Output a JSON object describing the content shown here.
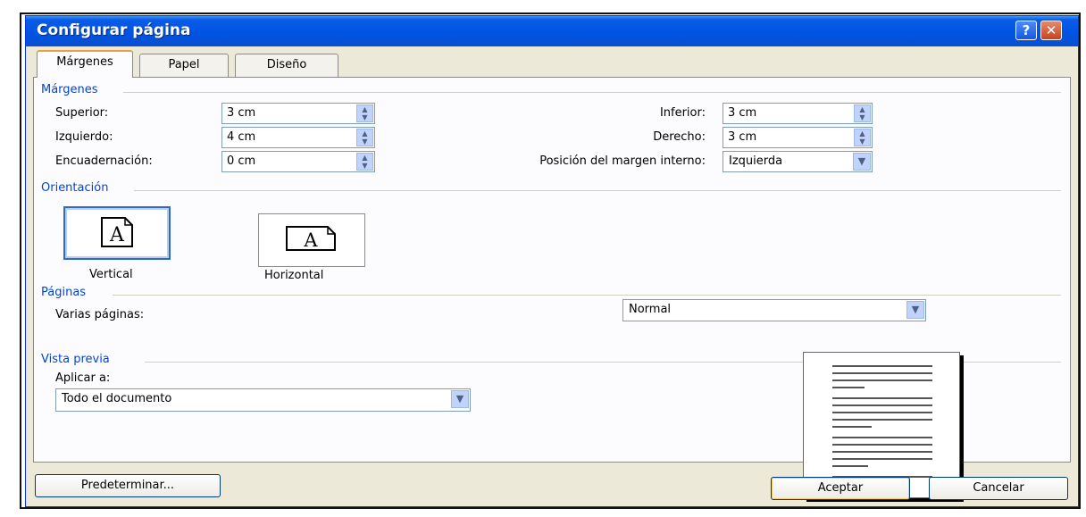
{
  "window": {
    "title": "Configurar página",
    "help_glyph": "?",
    "close_glyph": "✕"
  },
  "tabs": [
    {
      "label": "Márgenes",
      "active": true
    },
    {
      "label": "Papel"
    },
    {
      "label": "Diseño"
    }
  ],
  "margins": {
    "section_title": "Márgenes",
    "superior": {
      "label": "Superior:",
      "value": "3 cm"
    },
    "izquierdo": {
      "label": "Izquierdo:",
      "value": "4 cm"
    },
    "encuadernacion": {
      "label": "Encuadernación:",
      "value": "0 cm"
    },
    "inferior": {
      "label": "Inferior:",
      "value": "3 cm"
    },
    "derecho": {
      "label": "Derecho:",
      "value": "3 cm"
    },
    "posicion": {
      "label": "Posición del margen interno:",
      "value": "Izquierda"
    }
  },
  "orientation": {
    "section_title": "Orientación",
    "vertical": "Vertical",
    "horizontal": "Horizontal",
    "selected": "Vertical",
    "glyph": "A"
  },
  "pages": {
    "section_title": "Páginas",
    "label": "Varias páginas:",
    "value": "Normal"
  },
  "preview": {
    "section_title": "Vista previa",
    "apply_label": "Aplicar a:",
    "apply_value": "Todo el documento"
  },
  "buttons": {
    "default": "Predeterminar...",
    "ok": "Aceptar",
    "cancel": "Cancelar"
  },
  "colors": {
    "title_bar": "#0054e3",
    "section_text": "#0046d5",
    "dialog_bg": "#ece9d8"
  }
}
